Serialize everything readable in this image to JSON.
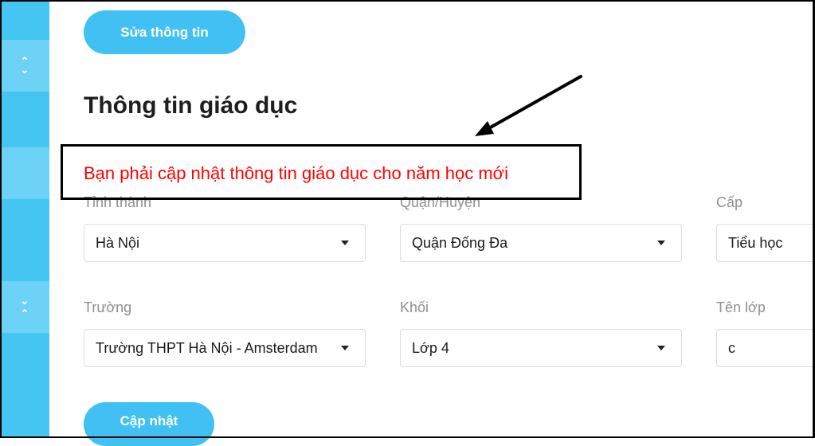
{
  "sidebar": {
    "expand_icon": "chevron-up-down-icon",
    "collapse_icon": "chevron-down-up-icon"
  },
  "buttons": {
    "edit_label": "Sửa thông tin",
    "update_label": "Cập nhật"
  },
  "section": {
    "title": "Thông tin giáo dục"
  },
  "annotation": {
    "notice_text": "Bạn phải cập nhật thông tin giáo dục cho năm học mới",
    "arrow_icon": "arrow-icon"
  },
  "form": {
    "province": {
      "label": "Tỉnh thành",
      "value": "Hà Nội"
    },
    "district": {
      "label": "Quận/Huyện",
      "value": "Quận Đống Đa"
    },
    "level": {
      "label": "Cấp",
      "value": "Tiểu học"
    },
    "school": {
      "label": "Trường",
      "value": "Trường THPT Hà Nội - Amsterdam"
    },
    "grade": {
      "label": "Khối",
      "value": "Lớp 4"
    },
    "class_name": {
      "label": "Tên lớp",
      "value": "c"
    }
  },
  "colors": {
    "accent": "#40c0f3",
    "notice": "#ff0000"
  }
}
